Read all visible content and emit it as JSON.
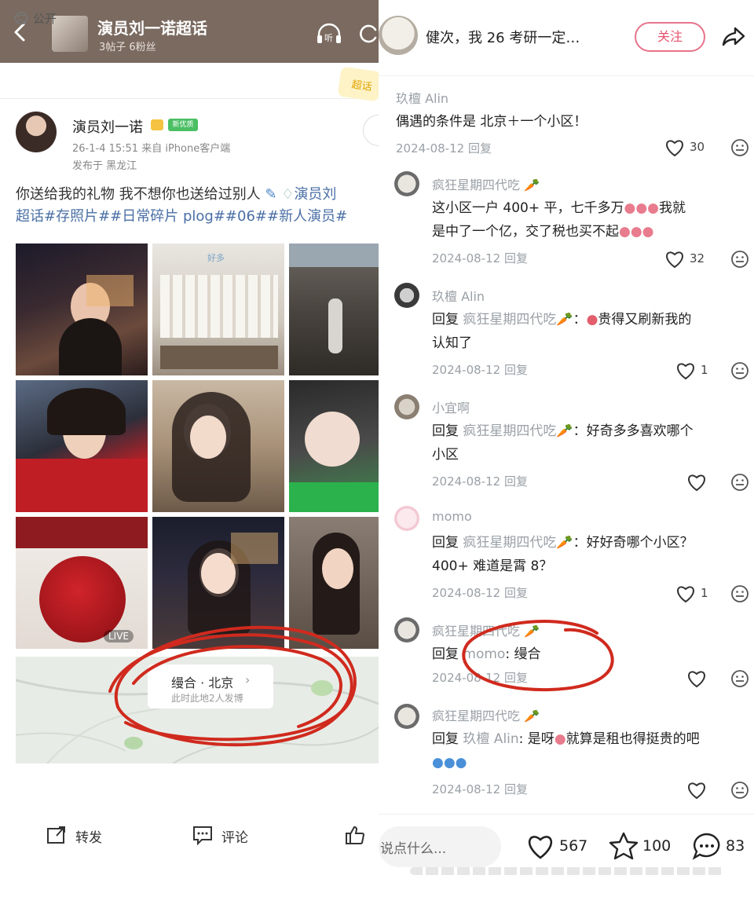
{
  "left": {
    "header": {
      "title": "演员刘一诺超话",
      "subtitle": "3帖子 6粉丝",
      "listen_label": "听"
    },
    "visibility": "公开",
    "sticker": "超话",
    "post": {
      "author": "演员刘一诺",
      "author_badge": "新优质",
      "meta": "26-1-4 15:51  来自 iPhone客户端",
      "location": "发布于 黑龙江",
      "text_plain": "你送给我的礼物 我不想你也送给过别人",
      "text_tag_line1": "演员刘",
      "text_line2": "超话#存照片##日常碎片 plog##06##新人演员#",
      "photo_caption": "好多",
      "live_label": "LIVE",
      "map": {
        "title": "缦合 · 北京",
        "subtitle": "此时此地2人发博"
      }
    },
    "actions": {
      "repost": "转发",
      "comment": "评论"
    }
  },
  "right": {
    "header": {
      "title": "健次，我 26 考研一定…",
      "follow": "关注"
    },
    "comments": [
      {
        "name": "玖檀 Alin",
        "text": "偶遇的条件是  北京＋一个小区！",
        "time": "2024-08-12 回复",
        "likes": "30"
      },
      {
        "name": "疯狂星期四代吃",
        "text_line1": "这小区一户 400+ 平，七千多万",
        "text_line1_tail": "我就",
        "text_line2": "是中了一个亿，交了税也买不起",
        "time": "2024-08-12 回复",
        "likes": "32"
      },
      {
        "name": "玖檀 Alin",
        "reply_prefix": "回复 ",
        "reply_to": "疯狂星期四代吃",
        "text_line1": "：",
        "text_line1_tail": "贵得又刷新我的",
        "text_line2": "认知了",
        "time": "2024-08-12 回复",
        "likes": "1"
      },
      {
        "name": "小宜啊",
        "reply_prefix": "回复 ",
        "reply_to": "疯狂星期四代吃",
        "text_line1": "：好奇多多喜欢哪个",
        "text_line2": "小区",
        "time": "2024-08-12 回复",
        "likes": ""
      },
      {
        "name": "momo",
        "reply_prefix": "回复 ",
        "reply_to": "疯狂星期四代吃",
        "text_line1": "：好好奇哪个小区？",
        "text_line2": "400+ 难道是霄 8？",
        "time": "2024-08-12 回复",
        "likes": "1"
      },
      {
        "name": "疯狂星期四代吃",
        "reply_prefix": "回复 ",
        "reply_to": "momo",
        "text_line1": ": 缦合",
        "time": "2024-08-12 回复",
        "likes": ""
      },
      {
        "name": "疯狂星期四代吃",
        "reply_prefix": "回复 ",
        "reply_to": "玖檀 Alin",
        "text_line1": ": 是呀",
        "text_line1_tail": "就算是租也得挺贵的吧",
        "time": "2024-08-12 回复",
        "likes": ""
      }
    ],
    "bottom": {
      "input_placeholder": "说点什么...",
      "likes": "567",
      "stars": "100",
      "comments": "83"
    }
  },
  "colors": {
    "left_header_bg": "#7a6a60",
    "accent_pink": "#e8536f",
    "muted_gray": "#9aa0a6",
    "annotation_red": "#d02a1e"
  }
}
